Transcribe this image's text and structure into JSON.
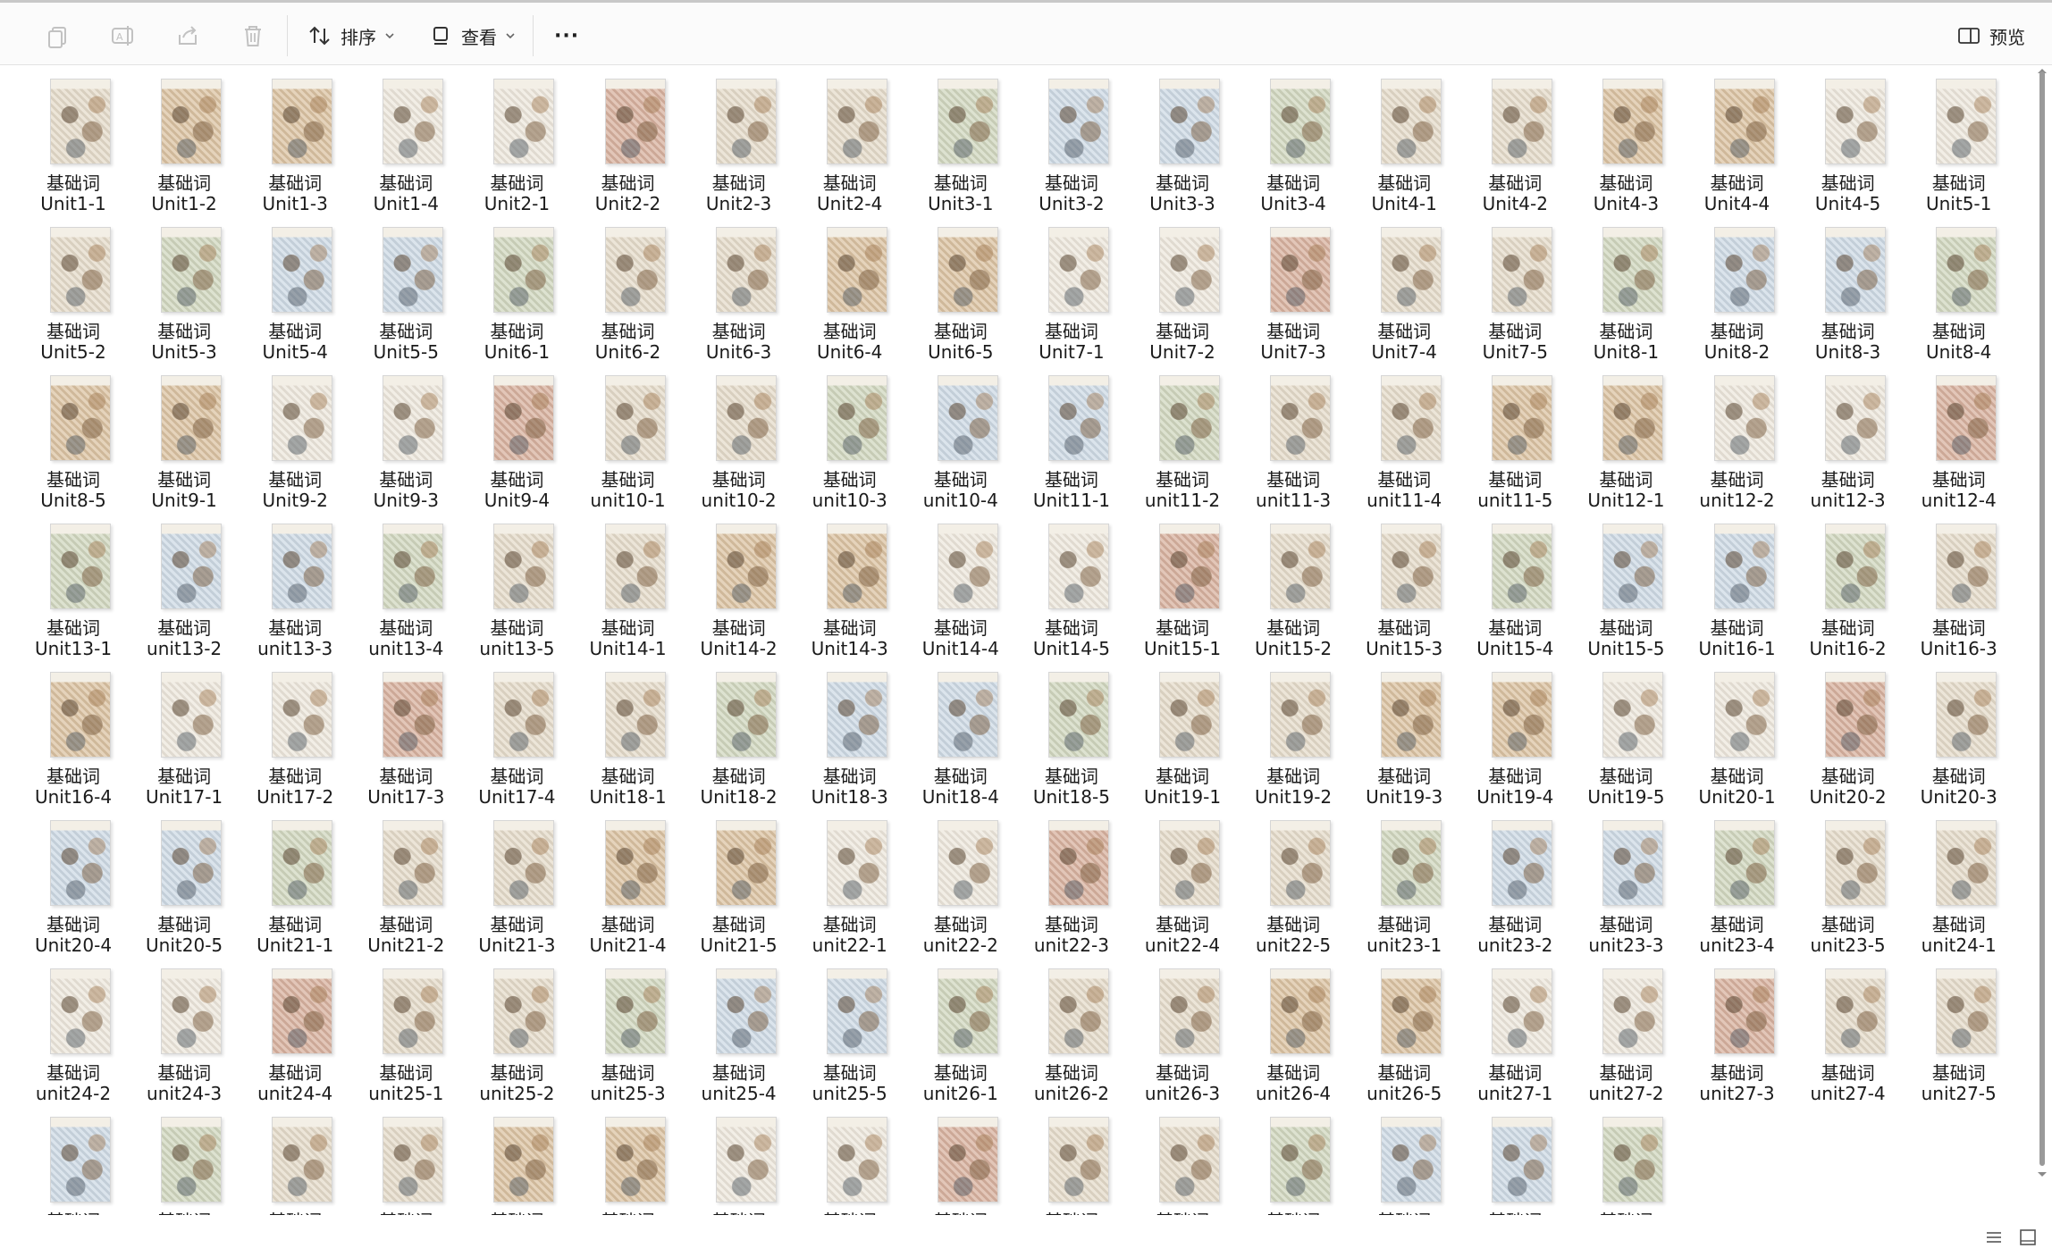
{
  "toolbar": {
    "icons": [
      "copy-icon",
      "rename-icon",
      "share-icon",
      "delete-icon"
    ],
    "sort_label": "排序",
    "view_label": "查看",
    "more_label": "···",
    "preview_label": "预览"
  },
  "file_prefix": "基础词",
  "files": [
    "Unit1-1",
    "Unit1-2",
    "Unit1-3",
    "Unit1-4",
    "Unit2-1",
    "Unit2-2",
    "Unit2-3",
    "Unit2-4",
    "Unit3-1",
    "Unit3-2",
    "Unit3-3",
    "Unit3-4",
    "Unit4-1",
    "Unit4-2",
    "Unit4-3",
    "Unit4-4",
    "Unit4-5",
    "Unit5-1",
    "Unit5-2",
    "Unit5-3",
    "Unit5-4",
    "Unit5-5",
    "Unit6-1",
    "Unit6-2",
    "Unit6-3",
    "Unit6-4",
    "Unit6-5",
    "Unit7-1",
    "Unit7-2",
    "Unit7-3",
    "Unit7-4",
    "Unit7-5",
    "Unit8-1",
    "Unit8-2",
    "Unit8-3",
    "Unit8-4",
    "Unit8-5",
    "Unit9-1",
    "Unit9-2",
    "Unit9-3",
    "Unit9-4",
    "unit10-1",
    "unit10-2",
    "unit10-3",
    "unit10-4",
    "Unit11-1",
    "unit11-2",
    "unit11-3",
    "unit11-4",
    "unit11-5",
    "Unit12-1",
    "unit12-2",
    "unit12-3",
    "unit12-4",
    "Unit13-1",
    "unit13-2",
    "unit13-3",
    "unit13-4",
    "unit13-5",
    "Unit14-1",
    "Unit14-2",
    "Unit14-3",
    "Unit14-4",
    "Unit14-5",
    "Unit15-1",
    "Unit15-2",
    "Unit15-3",
    "Unit15-4",
    "Unit15-5",
    "Unit16-1",
    "Unit16-2",
    "Unit16-3",
    "Unit16-4",
    "Unit17-1",
    "Unit17-2",
    "Unit17-3",
    "Unit17-4",
    "Unit18-1",
    "Unit18-2",
    "Unit18-3",
    "Unit18-4",
    "Unit18-5",
    "Unit19-1",
    "Unit19-2",
    "Unit19-3",
    "Unit19-4",
    "Unit19-5",
    "Unit20-1",
    "Unit20-2",
    "Unit20-3",
    "Unit20-4",
    "Unit20-5",
    "Unit21-1",
    "Unit21-2",
    "Unit21-3",
    "Unit21-4",
    "Unit21-5",
    "unit22-1",
    "unit22-2",
    "unit22-3",
    "unit22-4",
    "unit22-5",
    "unit23-1",
    "unit23-2",
    "unit23-3",
    "unit23-4",
    "unit23-5",
    "unit24-1",
    "unit24-2",
    "unit24-3",
    "unit24-4",
    "unit25-1",
    "unit25-2",
    "unit25-3",
    "unit25-4",
    "unit25-5",
    "unit26-1",
    "unit26-2",
    "unit26-3",
    "unit26-4",
    "unit26-5",
    "unit27-1",
    "unit27-2",
    "unit27-3",
    "unit27-4",
    "unit27-5"
  ],
  "partial_row_count": 15,
  "status_icons": [
    "details-view-icon",
    "large-icons-view-icon"
  ]
}
